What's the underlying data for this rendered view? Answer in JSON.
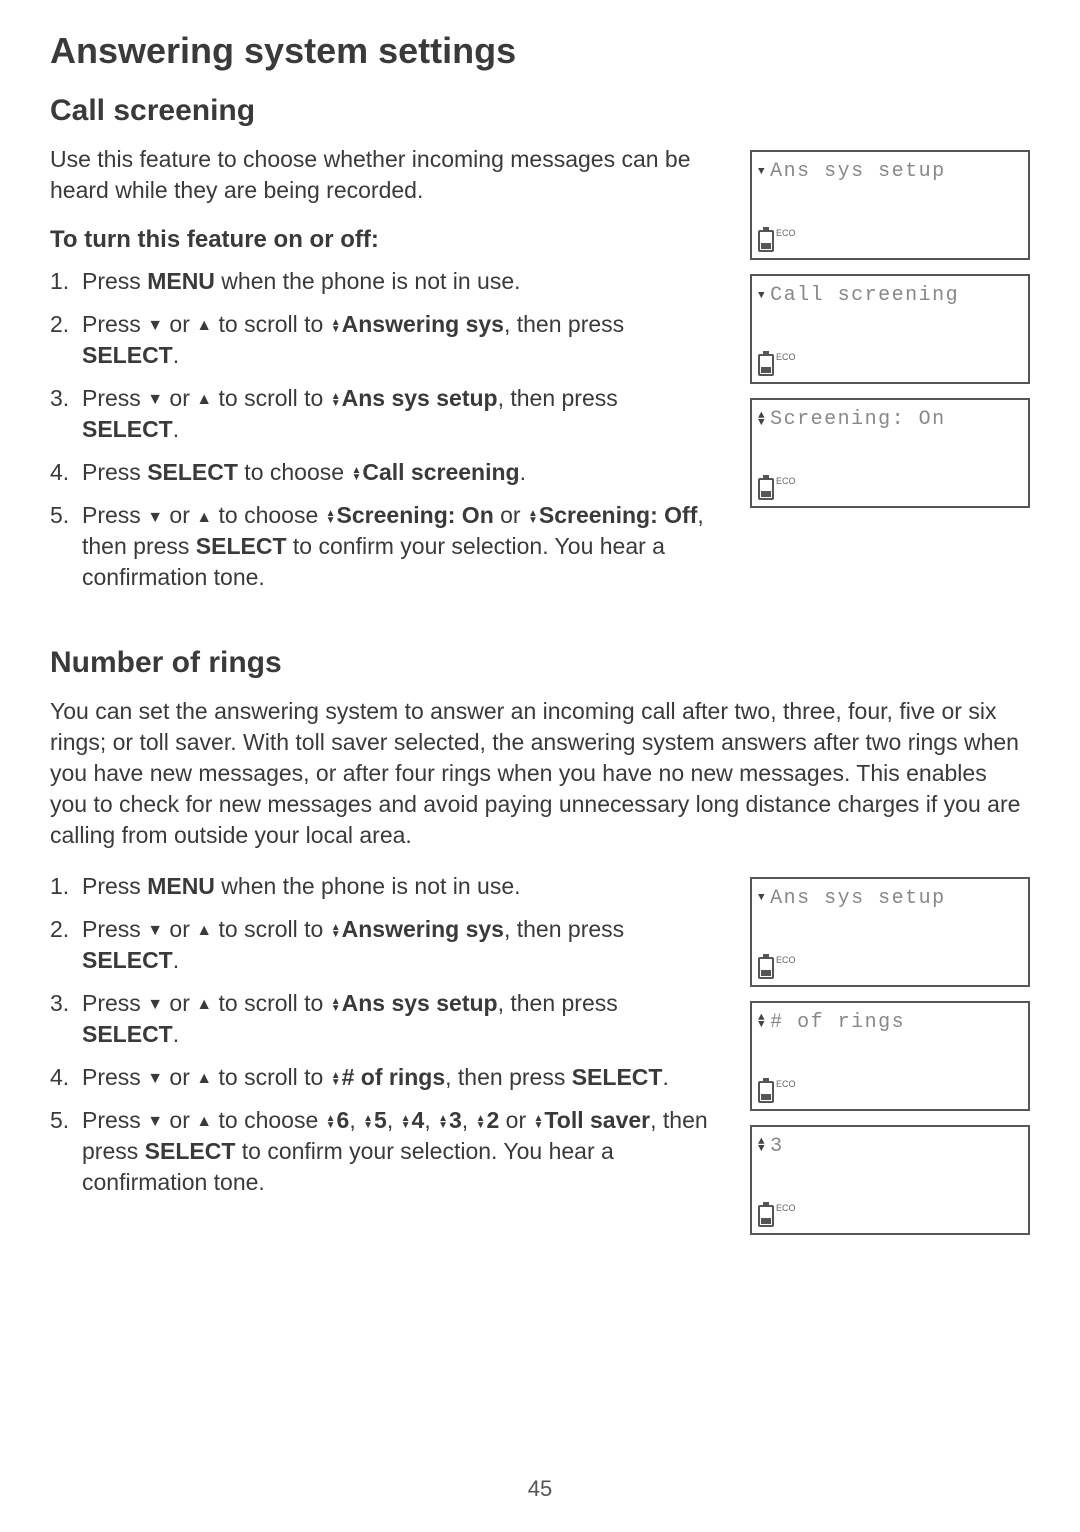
{
  "page": {
    "number": "45",
    "title": "Answering system settings"
  },
  "section1": {
    "heading": "Call screening",
    "intro": "Use this feature to choose whether incoming messages can be heard while they are being recorded.",
    "sub": "To turn this feature on or off:",
    "steps": {
      "s1_a": "Press ",
      "s1_b": "MENU",
      "s1_c": " when the phone is not in use.",
      "s2_a": "Press ",
      "s2_b": " or ",
      "s2_c": " to scroll to ",
      "s2_d": "Answering sys",
      "s2_e": ", then press ",
      "s2_f": "SELECT",
      "s2_g": ".",
      "s3_a": "Press ",
      "s3_b": " or ",
      "s3_c": " to scroll to ",
      "s3_d": "Ans sys setup",
      "s3_e": ", then press ",
      "s3_f": "SELECT",
      "s3_g": ".",
      "s4_a": "Press ",
      "s4_b": "SELECT",
      "s4_c": " to choose ",
      "s4_d": "Call screening",
      "s4_e": ".",
      "s5_a": "Press ",
      "s5_b": " or ",
      "s5_c": " to choose ",
      "s5_d": "Screening: On",
      "s5_e": " or ",
      "s5_f": "Screening: Off",
      "s5_g": ", then press ",
      "s5_h": "SELECT",
      "s5_i": " to confirm your selection. You hear a confirmation tone."
    },
    "lcds": {
      "l1": "Ans sys setup",
      "l2": "Call screening",
      "l3": "Screening: On",
      "eco": "ECO"
    }
  },
  "section2": {
    "heading": "Number of rings",
    "intro": "You can set the answering system to answer an incoming call after two, three, four, five or six rings; or toll saver. With toll saver selected, the answering system answers after two rings when you have new messages, or after four rings when you have no new messages. This enables you to check for new messages and avoid paying unnecessary long distance charges if you are calling from outside your local area.",
    "steps": {
      "s1_a": "Press ",
      "s1_b": "MENU",
      "s1_c": " when the phone is not in use.",
      "s2_a": "Press ",
      "s2_b": " or ",
      "s2_c": " to scroll to ",
      "s2_d": "Answering sys",
      "s2_e": ", then press ",
      "s2_f": "SELECT",
      "s2_g": ".",
      "s3_a": "Press ",
      "s3_b": " or ",
      "s3_c": " to scroll to ",
      "s3_d": "Ans sys setup",
      "s3_e": ", then press ",
      "s3_f": "SELECT",
      "s3_g": ".",
      "s4_a": "Press ",
      "s4_b": " or ",
      "s4_c": " to scroll to ",
      "s4_d": "# of rings",
      "s4_e": ", then press ",
      "s4_f": "SELECT",
      "s4_g": ".",
      "s5_a": "Press ",
      "s5_b": " or ",
      "s5_c": " to choose ",
      "s5_d": "6",
      "s5_e": ", ",
      "s5_f": "5",
      "s5_g": ", ",
      "s5_h": "4",
      "s5_i": ", ",
      "s5_j": "3",
      "s5_k": ", ",
      "s5_l": "2",
      "s5_m": " or ",
      "s5_n": "Toll saver",
      "s5_o": ", then press ",
      "s5_p": "SELECT",
      "s5_q": " to confirm your selection. You hear a confirmation tone."
    },
    "lcds": {
      "l1": "Ans sys setup",
      "l2": "# of rings",
      "l3": "3",
      "eco": "ECO"
    }
  }
}
